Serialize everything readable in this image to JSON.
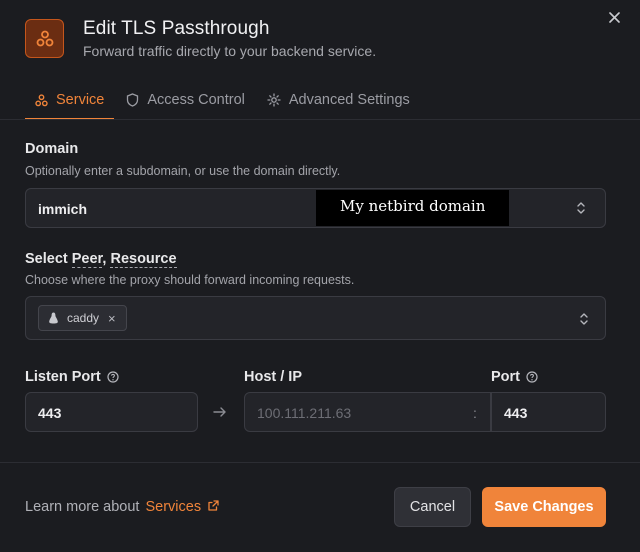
{
  "header": {
    "title": "Edit TLS Passthrough",
    "subtitle": "Forward traffic directly to your backend service."
  },
  "tabs": [
    {
      "label": "Service",
      "icon": "nodes-icon",
      "active": true
    },
    {
      "label": "Access Control",
      "icon": "shield-icon",
      "active": false
    },
    {
      "label": "Advanced Settings",
      "icon": "gear-icon",
      "active": false
    }
  ],
  "domain": {
    "label": "Domain",
    "hint": "Optionally enter a subdomain, or use the domain directly.",
    "value": "immich",
    "redaction_text": "My netbird domain"
  },
  "peer": {
    "label_prefix": "Select ",
    "label_peer": "Peer",
    "label_sep": ", ",
    "label_resource": "Resource",
    "hint": "Choose where the proxy should forward incoming requests.",
    "chip": {
      "label": "caddy",
      "remove": "×"
    }
  },
  "listen_port": {
    "label": "Listen Port",
    "value": "443"
  },
  "host": {
    "label": "Host / IP",
    "placeholder": "100.111.211.63",
    "separator": ":"
  },
  "port": {
    "label": "Port",
    "value": "443"
  },
  "footer": {
    "learn_more": "Learn more about",
    "link_label": "Services",
    "cancel_label": "Cancel",
    "save_label": "Save Changes"
  },
  "colors": {
    "accent": "#f0843a",
    "background": "#1b1c20",
    "field_bg": "#232429"
  }
}
